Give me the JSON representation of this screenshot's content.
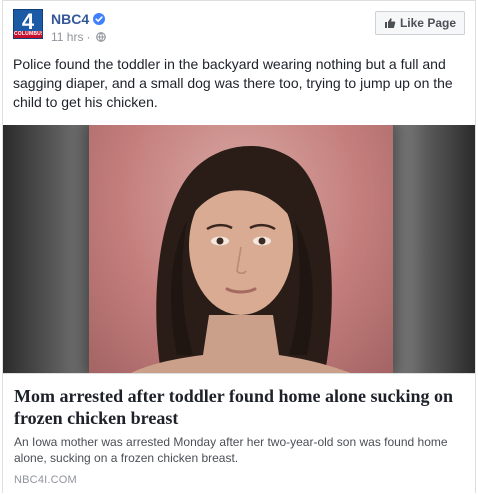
{
  "header": {
    "logo_number": "4",
    "logo_sub": "COLUMBUS",
    "page_name": "NBC4",
    "timestamp": "11 hrs",
    "separator": "·",
    "like_button_label": "Like Page"
  },
  "post": {
    "text": "Police found the toddler in the backyard wearing nothing but a full and sagging diaper, and a small dog was there too, trying to jump up on the child to get his chicken."
  },
  "link": {
    "headline": "Mom arrested after toddler found home alone sucking on frozen chicken breast",
    "description": "An Iowa mother was arrested Monday after her two-year-old son was found home alone, sucking on a frozen chicken breast.",
    "domain": "NBC4I.COM"
  },
  "colors": {
    "page_name": "#365899",
    "verified": "#4080ff",
    "logo_blue": "#1d5aa6",
    "logo_red": "#c8102e"
  },
  "icons": {
    "verified": "verified-badge-icon",
    "privacy": "globe-icon",
    "like": "thumbs-up-icon"
  }
}
